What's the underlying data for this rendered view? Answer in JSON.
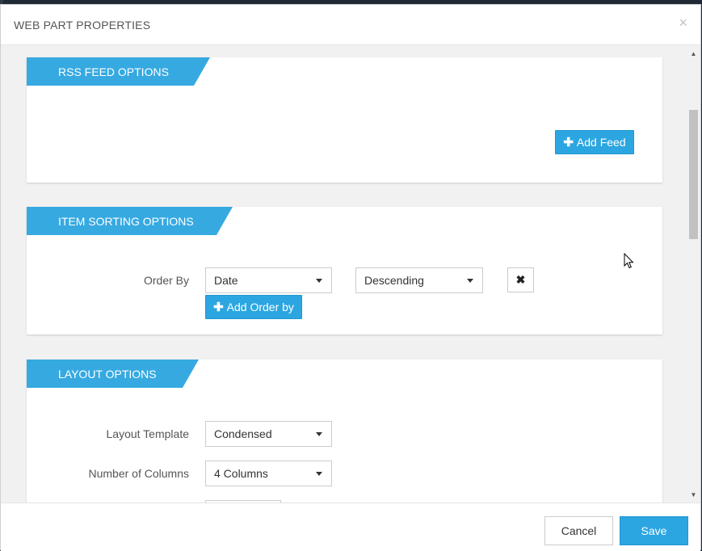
{
  "modal": {
    "title": "WEB PART PROPERTIES",
    "close_glyph": "×"
  },
  "rss_section": {
    "title": "RSS FEED OPTIONS",
    "add_feed_label": "Add Feed"
  },
  "sorting_section": {
    "title": "ITEM SORTING OPTIONS",
    "order_by_label": "Order By",
    "order_field_value": "Date",
    "order_direction_value": "Descending",
    "remove_glyph": "✖",
    "add_order_label": "Add Order by"
  },
  "layout_section": {
    "title": "LAYOUT OPTIONS",
    "template_label": "Layout Template",
    "template_value": "Condensed",
    "columns_label": "Number of Columns",
    "columns_value": "4 Columns"
  },
  "footer": {
    "cancel_label": "Cancel",
    "save_label": "Save"
  },
  "icons": {
    "plus": "plus-icon",
    "caret": "caret-down-icon",
    "close": "close-icon",
    "remove": "times-icon"
  },
  "colors": {
    "accent": "#36a9e1",
    "button_primary": "#2ba6e1",
    "body_bg": "#f1f1f1"
  }
}
